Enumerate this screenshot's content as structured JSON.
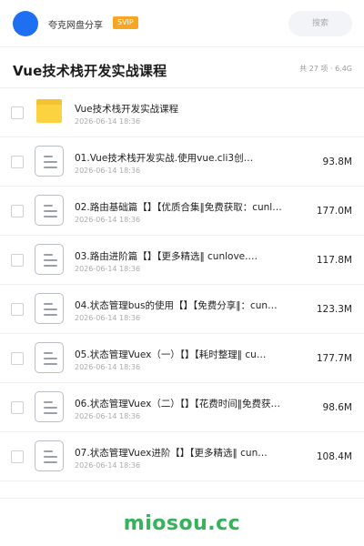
{
  "header": {
    "brand": "夸克网盘分享",
    "badge": "SVIP",
    "search_placeholder": "搜索"
  },
  "folder": {
    "title": "Vue技术栈开发实战课程",
    "meta": "共 27 项 · 6.4G"
  },
  "items": [
    {
      "type": "folder",
      "name": "Vue技术栈开发实战课程",
      "date": "2026-06-14 18:36",
      "size": ""
    },
    {
      "type": "file",
      "name": "01.Vue技术栈开发实战.使用vue.cli3创…",
      "date": "2026-06-14 18:36",
      "size": "93.8M"
    },
    {
      "type": "file",
      "name": "02.路由基础篇【】【优质合集‖免费获取：cunl…",
      "date": "2026-06-14 18:36",
      "size": "177.0M"
    },
    {
      "type": "file",
      "name": "03.路由进阶篇【】【更多精选‖ cunlove.…",
      "date": "2026-06-14 18:36",
      "size": "117.8M"
    },
    {
      "type": "file",
      "name": "04.状态管理bus的使用【】【免费分享‖：cun…",
      "date": "2026-06-14 18:36",
      "size": "123.3M"
    },
    {
      "type": "file",
      "name": "05.状态管理Vuex（一）【】【耗时整理‖ cu…",
      "date": "2026-06-14 18:36",
      "size": "177.7M"
    },
    {
      "type": "file",
      "name": "06.状态管理Vuex（二）【】【花费时间‖免费获…",
      "date": "2026-06-14 18:36",
      "size": "98.6M"
    },
    {
      "type": "file",
      "name": "07.状态管理Vuex进阶【】【更多精选‖ cun…",
      "date": "2026-06-14 18:36",
      "size": "108.4M"
    }
  ],
  "footer": {
    "watermark": "miosou.cc"
  },
  "colors": {
    "avatar": "#1e6ff2",
    "badge": "#f6a623",
    "folder": "#fbd240",
    "watermark": "#35b25a"
  },
  "icons": {
    "folder": "folder-icon",
    "file": "document-icon"
  }
}
